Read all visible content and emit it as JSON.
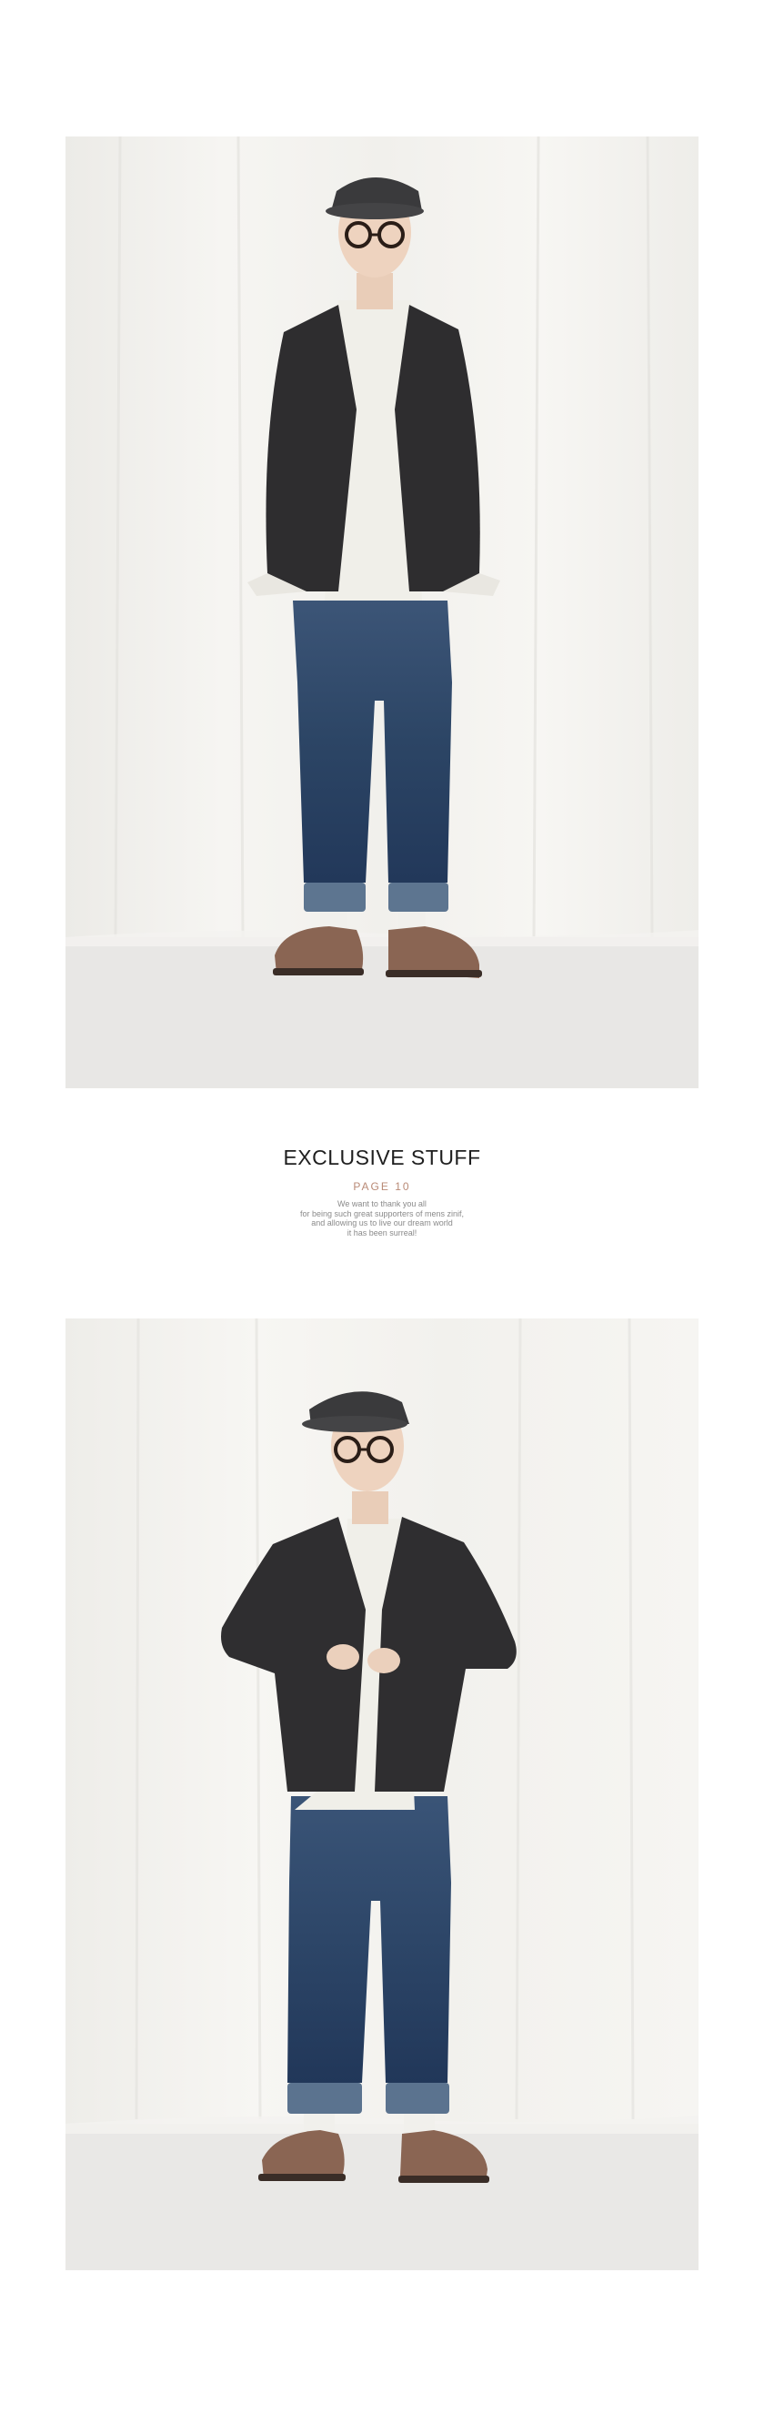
{
  "caption": {
    "title": "EXCLUSIVE STUFF",
    "page_label": "PAGE 10",
    "body_lines": [
      "We want to thank you all",
      "for being such great supporters of mens zinif,",
      "and allowing us to live our dream world",
      "it has been surreal!"
    ]
  },
  "colors": {
    "accent": "#b98a76",
    "title": "#1f1f1f",
    "body_text": "#8a8a8a",
    "backdrop": "#f3f2ee",
    "floor": "#e9e8e6",
    "blazer": "#2e2d2f",
    "jeans": "#2f4a6c",
    "shoes": "#8a6553"
  }
}
